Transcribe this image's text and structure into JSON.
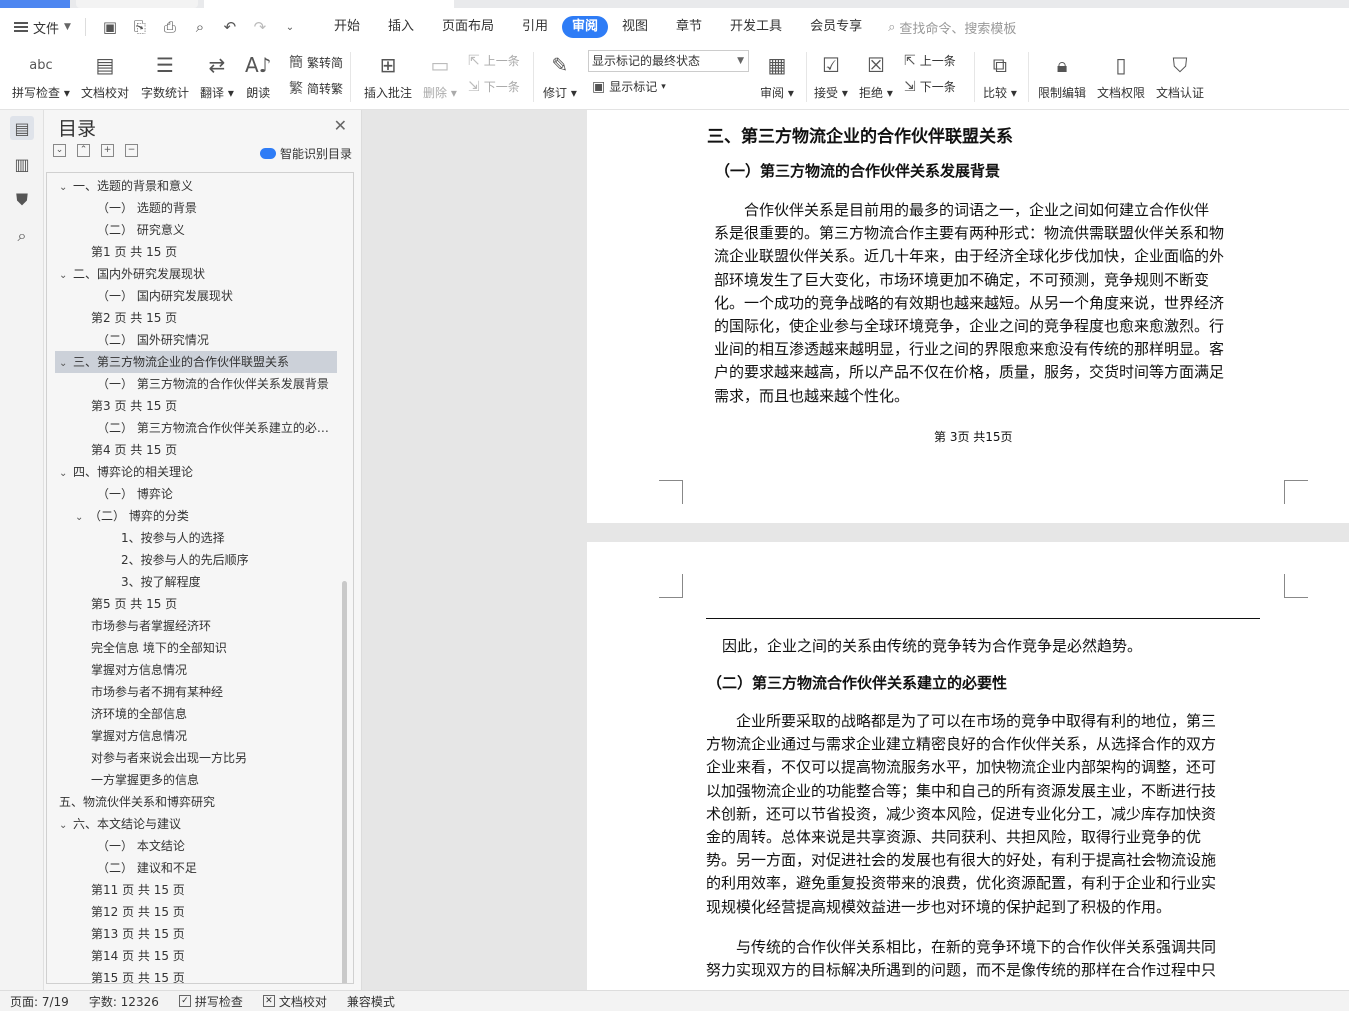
{
  "menubar": {
    "file_label": "文件",
    "tabs": [
      "开始",
      "插入",
      "页面布局",
      "引用",
      "审阅",
      "视图",
      "章节",
      "开发工具",
      "会员专享"
    ],
    "active_tab": "审阅",
    "search_placeholder": "查找命令、搜索模板"
  },
  "toolbar": {
    "spell_check": "拼写检查",
    "doc_proof": "文档校对",
    "word_count": "字数统计",
    "translate": "翻译",
    "read_aloud": "朗读",
    "trad_to_simp": "繁转简",
    "simp_to_trad": "简转繁",
    "insert_comment": "插入批注",
    "delete": "删除",
    "prev_comment": "上一条",
    "next_comment": "下一条",
    "track_changes": "修订",
    "markup_mode": "显示标记的最终状态",
    "show_markup": "显示标记",
    "review": "审阅",
    "accept": "接受",
    "reject": "拒绝",
    "prev_change": "上一条",
    "next_change": "下一条",
    "compare": "比较",
    "restrict_edit": "限制编辑",
    "doc_permission": "文档权限",
    "doc_auth": "文档认证"
  },
  "toc": {
    "title": "目录",
    "smart_label": "智能识别目录",
    "items": [
      {
        "text": "一、选题的背景和意义",
        "level": 1,
        "expander": "v"
      },
      {
        "text": "（一） 选题的背景",
        "level": 2,
        "expander": ""
      },
      {
        "text": "（二） 研究意义",
        "level": 2,
        "expander": ""
      },
      {
        "text": "第1 页 共 15 页",
        "level": 1.5,
        "expander": ""
      },
      {
        "text": "二、国内外研究发展现状",
        "level": 1,
        "expander": "v"
      },
      {
        "text": "（一） 国内研究发展现状",
        "level": 2,
        "expander": ""
      },
      {
        "text": "第2 页 共 15 页",
        "level": 1.5,
        "expander": ""
      },
      {
        "text": "（二） 国外研究情况",
        "level": 2,
        "expander": ""
      },
      {
        "text": "三、第三方物流企业的合作伙伴联盟关系",
        "level": 1,
        "expander": "v",
        "selected": true
      },
      {
        "text": "（一） 第三方物流的合作伙伴关系发展背景",
        "level": 2,
        "expander": ""
      },
      {
        "text": "第3 页 共 15 页",
        "level": 1.5,
        "expander": ""
      },
      {
        "text": "（二） 第三方物流合作伙伴关系建立的必要性",
        "level": 2,
        "expander": ""
      },
      {
        "text": "第4 页 共 15 页",
        "level": 1.5,
        "expander": ""
      },
      {
        "text": "四、博弈论的相关理论",
        "level": 1,
        "expander": "v"
      },
      {
        "text": "（一） 博弈论",
        "level": 2,
        "expander": ""
      },
      {
        "text": "（二） 博弈的分类",
        "level": 2,
        "expander": "v"
      },
      {
        "text": "1、按参与人的选择",
        "level": 3,
        "expander": ""
      },
      {
        "text": "2、按参与人的先后顺序",
        "level": 3,
        "expander": ""
      },
      {
        "text": "3、按了解程度",
        "level": 3,
        "expander": ""
      },
      {
        "text": "第5 页 共 15 页",
        "level": 1.5,
        "expander": ""
      },
      {
        "text": "市场参与者掌握经济环",
        "level": 1.5,
        "expander": ""
      },
      {
        "text": "完全信息 境下的全部知识",
        "level": 1.5,
        "expander": ""
      },
      {
        "text": "掌握对方信息情况",
        "level": 1.5,
        "expander": ""
      },
      {
        "text": "市场参与者不拥有某种经",
        "level": 1.5,
        "expander": ""
      },
      {
        "text": "济环境的全部信息",
        "level": 1.5,
        "expander": ""
      },
      {
        "text": "掌握对方信息情况",
        "level": 1.5,
        "expander": ""
      },
      {
        "text": "对参与者来说会出现一方比另",
        "level": 1.5,
        "expander": ""
      },
      {
        "text": "一方掌握更多的信息",
        "level": 1.5,
        "expander": ""
      },
      {
        "text": "五、物流伙伴关系和博弈研究",
        "level": 1,
        "expander": ""
      },
      {
        "text": "六、本文结论与建议",
        "level": 1,
        "expander": "v"
      },
      {
        "text": "（一） 本文结论",
        "level": 2,
        "expander": ""
      },
      {
        "text": "（二） 建议和不足",
        "level": 2,
        "expander": ""
      },
      {
        "text": "第11 页 共 15 页",
        "level": 1.5,
        "expander": ""
      },
      {
        "text": "第12 页 共 15 页",
        "level": 1.5,
        "expander": ""
      },
      {
        "text": "第13 页 共 15 页",
        "level": 1.5,
        "expander": ""
      },
      {
        "text": "第14 页 共 15 页",
        "level": 1.5,
        "expander": ""
      },
      {
        "text": "第15 页 共 15 页",
        "level": 1.5,
        "expander": ""
      }
    ]
  },
  "doc": {
    "page1": {
      "heading": "三、第三方物流企业的合作伙伴联盟关系",
      "subheading": "（一）第三方物流的合作伙伴关系发展背景",
      "para_lines": [
        "合作伙伴关系是目前用的最多的词语之一，企业之间如何建立合作伙伴",
        "系是很重要的。第三方物流合作主要有两种形式：物流供需联盟伙伴关系和物",
        "流企业联盟伙伴关系。近几十年来，由于经济全球化步伐加快，企业面临的外",
        "部环境发生了巨大变化，市场环境更加不确定，不可预测，竞争规则不断变",
        "化。一个成功的竞争战略的有效期也越来越短。从另一个角度来说，世界经济",
        "的国际化，使企业参与全球环境竞争，企业之间的竞争程度也愈来愈激烈。行",
        "业间的相互渗透越来越明显，行业之间的界限愈来愈没有传统的那样明显。客",
        "户的要求越来越高，所以产品不仅在价格，质量，服务，交货时间等方面满足",
        "需求，而且也越来越个性化。"
      ],
      "page_number": "第 3页 共15页"
    },
    "page2": {
      "first_line": "因此，企业之间的关系由传统的竞争转为合作竞争是必然趋势。",
      "subheading": "（二）第三方物流合作伙伴关系建立的必要性",
      "para1_lines": [
        "企业所要采取的战略都是为了可以在市场的竞争中取得有利的地位，第三",
        "方物流企业通过与需求企业建立精密良好的合作伙伴关系，从选择合作的双方",
        "企业来看，不仅可以提高物流服务水平，加快物流企业内部架构的调整，还可",
        "以加强物流企业的功能整合等；集中和自己的所有资源发展主业，不断进行技",
        "术创新，还可以节省投资，减少资本风险，促进专业化分工，减少库存加快资",
        "金的周转。总体来说是共享资源、共同获利、共担风险，取得行业竞争的优",
        "势。另一方面，对促进社会的发展也有很大的好处，有利于提高社会物流设施",
        "的利用效率，避免重复投资带来的浪费，优化资源配置，有利于企业和行业实",
        "现规模化经营提高规模效益进一步也对环境的保护起到了积极的作用。"
      ],
      "para2_lines": [
        "与传统的合作伙伴关系相比，在新的竞争环境下的合作伙伴关系强调共同",
        "努力实现双方的目标解决所遇到的问题，而不是像传统的那样在合作过程中只"
      ]
    }
  },
  "status": {
    "page": "页面: 7/19",
    "words": "字数: 12326",
    "spell": "拼写检查",
    "proof": "文档校对",
    "compat": "兼容模式"
  }
}
